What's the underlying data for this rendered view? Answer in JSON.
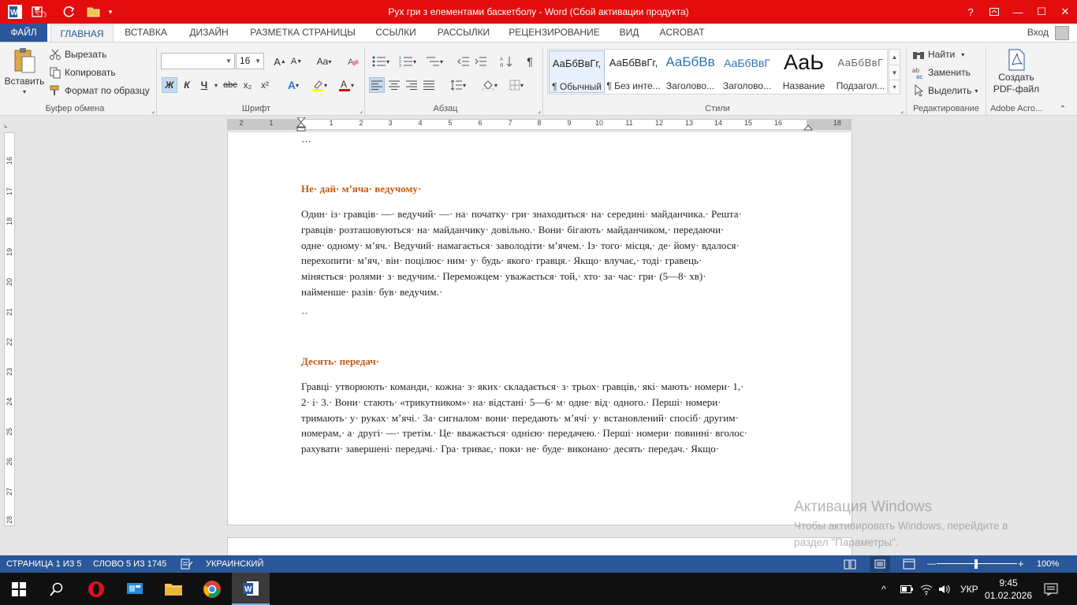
{
  "window": {
    "title": "Рух гри з елементами баскетболу -  Word (Сбой активации продукта)",
    "help": "?",
    "minimize": "—",
    "maximize": "☐",
    "close": "✕"
  },
  "tabs": {
    "file": "ФАЙЛ",
    "items": [
      "ГЛАВНАЯ",
      "ВСТАВКА",
      "ДИЗАЙН",
      "РАЗМЕТКА СТРАНИЦЫ",
      "ССЫЛКИ",
      "РАССЫЛКИ",
      "РЕЦЕНЗИРОВАНИЕ",
      "ВИД",
      "ACROBAT"
    ],
    "signin": "Вход"
  },
  "ribbon": {
    "clipboard": {
      "paste": "Вставить",
      "cut": "Вырезать",
      "copy": "Копировать",
      "format_painter": "Формат по образцу",
      "label": "Буфер обмена"
    },
    "font": {
      "name": "",
      "size": "16",
      "label": "Шрифт",
      "bold": "Ж",
      "italic": "К",
      "underline": "Ч",
      "strike": "abc",
      "sub": "x₂",
      "sup": "x²",
      "case": "Aa"
    },
    "paragraph": {
      "label": "Абзац"
    },
    "styles": {
      "label": "Стили",
      "items": [
        {
          "sample": "АаБбВвГг,",
          "name": "¶ Обычный"
        },
        {
          "sample": "АаБбВвГг,",
          "name": "¶ Без инте..."
        },
        {
          "sample": "АаБбВв",
          "name": "Заголово..."
        },
        {
          "sample": "АаБбВвГ",
          "name": "Заголово..."
        },
        {
          "sample": "АаЬ",
          "name": "Название"
        },
        {
          "sample": "АаБбВвГ",
          "name": "Подзагол..."
        }
      ]
    },
    "editing": {
      "find": "Найти",
      "replace": "Заменить",
      "select": "Выделить",
      "label": "Редактирование"
    },
    "acrobat": {
      "create_pdf_line1": "Создать",
      "create_pdf_line2": "PDF-файл",
      "label": "Adobe Acro..."
    }
  },
  "ruler": {
    "h_ticks": [
      "2",
      "1",
      "1",
      "2",
      "3",
      "4",
      "5",
      "6",
      "7",
      "8",
      "9",
      "10",
      "11",
      "12",
      "13",
      "14",
      "15",
      "16",
      "18"
    ],
    "v_ticks": [
      "16",
      "17",
      "18",
      "19",
      "20",
      "21",
      "22",
      "23",
      "24",
      "25",
      "26",
      "27",
      "28"
    ]
  },
  "document": {
    "dots_top": "···",
    "heading1": "Не· дай· м’яча· ведучому·",
    "p1": [
      "Один· із· гравців· —· ведучий· —· на· початку· гри· знаходиться· на· середині· майданчика.· Решта·",
      "гравців· розташовуються· на· майданчику· довільно.· Вони· бігають· майданчиком,· передаючи·",
      "одне· одному· м’яч.· Ведучий· намагається· заволодіти· м’ячем.· Із· того· місця,· де· йому· вдалося·",
      "перехопити· м’яч,· він· поцілює· ним· у· будь· якого· гравця.· Якщо· влучає,· тоді· гравець·",
      "міняється· ролями· з· ведучим.· Переможцем· уважається· той,· хто· за· час· гри· (5—8· хв)·",
      "найменше· разів· був· ведучим.·"
    ],
    "dots_mid": "··",
    "heading2": "Десять· передач·",
    "p2": [
      "Гравці· утворюють· команди,· кожна· з· яких· складається· з· трьох· гравців,· які· мають· номери· 1,·",
      "2· і· 3.· Вони· стають· «трикутником»· на· відстані· 5—6· м· одне· від· одного.· Перші· номери·",
      "тримають· у· руках· м’ячі.· За· сигналом· вони· передають· м’ячі· у· встановлений· спосіб· другим·",
      "номерам,· а· другі· —· третім.· Це· вважається· однією· передачею.· Перші· номери· повинні· вголос·",
      "рахувати· завершені· передачі.· Гра· триває,· поки· не· буде· виконано· десять· передач.· Якщо·"
    ]
  },
  "watermark": {
    "title": "Активация Windows",
    "line1": "Чтобы активировать Windows, перейдите в",
    "line2": "раздел \"Параметры\"."
  },
  "status": {
    "page": "СТРАНИЦА 1 ИЗ 5",
    "words": "СЛОВО 5 ИЗ 1745",
    "language": "УКРАИНСКИЙ",
    "zoom": "100%"
  },
  "taskbar": {
    "lang": "УКР",
    "time": "9:45",
    "date": "01.02.2026"
  },
  "colors": {
    "word_blue": "#2b579a",
    "title_red": "#e30d0d",
    "heading_orange": "#c55a11"
  }
}
